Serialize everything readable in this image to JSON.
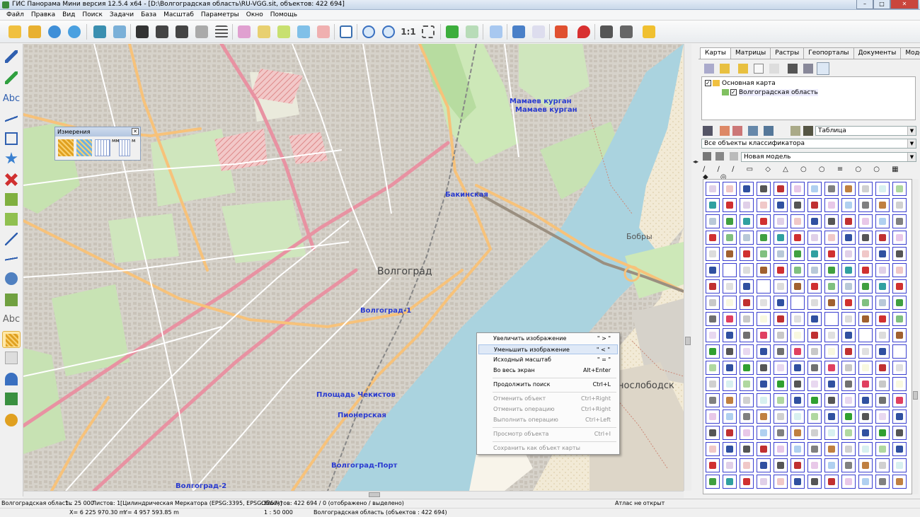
{
  "window": {
    "title": "ГИС Панорама Мини версия 12.5.4 x64 - [D:\\Волгоградская область\\RU-VGG.sit, объектов: 422 694]"
  },
  "menu": [
    "Файл",
    "Правка",
    "Вид",
    "Поиск",
    "Задачи",
    "База",
    "Масштаб",
    "Параметры",
    "Окно",
    "Помощь"
  ],
  "toolbar": {
    "scale_label": "1:1"
  },
  "left_tools": {
    "text_tool_1": "Abc",
    "text_tool_2": "Abc"
  },
  "measure_window": {
    "title": "Измерения",
    "unit_mm": "мм",
    "unit_m": "м"
  },
  "map_labels": {
    "mamaev1": "Мамаев курган",
    "mamaev2": "Мамаев курган",
    "bakinskaya": "Бакинская",
    "volgograd": "Волгоград",
    "volgograd1": "Волгоград-1",
    "bobry": "Бобры",
    "krasnoslobodsk": "нослободск",
    "chekistov": "Площадь Чекистов",
    "pionerskaya": "Пионерская",
    "port": "Волгоград-Порт",
    "volgograd2": "Волгоград-2"
  },
  "context_menu": [
    {
      "label": "Увеличить изображение",
      "shortcut": "\" > \"",
      "disabled": false
    },
    {
      "label": "Уменьшить изображение",
      "shortcut": "\" < \"",
      "disabled": false
    },
    {
      "label": "Исходный масштаб",
      "shortcut": "\" = \"",
      "disabled": false
    },
    {
      "label": "Во весь экран",
      "shortcut": "Alt+Enter",
      "disabled": false
    },
    {
      "label": "Продолжить поиск",
      "shortcut": "Ctrl+L",
      "disabled": false
    },
    {
      "label": "Отменить объект",
      "shortcut": "Ctrl+Right",
      "disabled": true
    },
    {
      "label": "Отменить операцию",
      "shortcut": "Ctrl+Right",
      "disabled": true
    },
    {
      "label": "Выполнить операцию",
      "shortcut": "Ctrl+Left",
      "disabled": true
    },
    {
      "label": "Просмотр объекта",
      "shortcut": "Ctrl+I",
      "disabled": true
    },
    {
      "label": "Сохранить как объект карты",
      "shortcut": "",
      "disabled": true
    }
  ],
  "panel": {
    "tabs": [
      "Карты",
      "Матрицы",
      "Растры",
      "Геопорталы",
      "Документы",
      "Модели"
    ],
    "tree": {
      "root": "Основная карта",
      "child": "Волгоградская область"
    },
    "view_combo": "Таблица",
    "filter_combo": "Все объекты классификатора",
    "model_combo": "Новая модель"
  },
  "status": {
    "map_name": "Волгоградская область",
    "scale": "1 : 25 000",
    "sheets": "Листов: 1",
    "projection": "[Цилиндрическая Меркатора (EPSG:3395, EPSG:3857)]",
    "objects": "Объектов: 422 694 / 0 (отображено / выделено)",
    "atlas": "Атлас не открыт",
    "x_coord": "X= 6 225 970.30 m",
    "y_coord": "Y= 4 957 593.85 m",
    "base_scale": "1 : 50 000",
    "layer_info": "Волгоградская область   (объектов : 422 694)"
  },
  "colors": {
    "accent": "#3a3fd0",
    "water": "#aad3df",
    "road_main": "#e892a2",
    "road_secondary": "#f7c27a",
    "label_blue": "#2a3bd0"
  }
}
